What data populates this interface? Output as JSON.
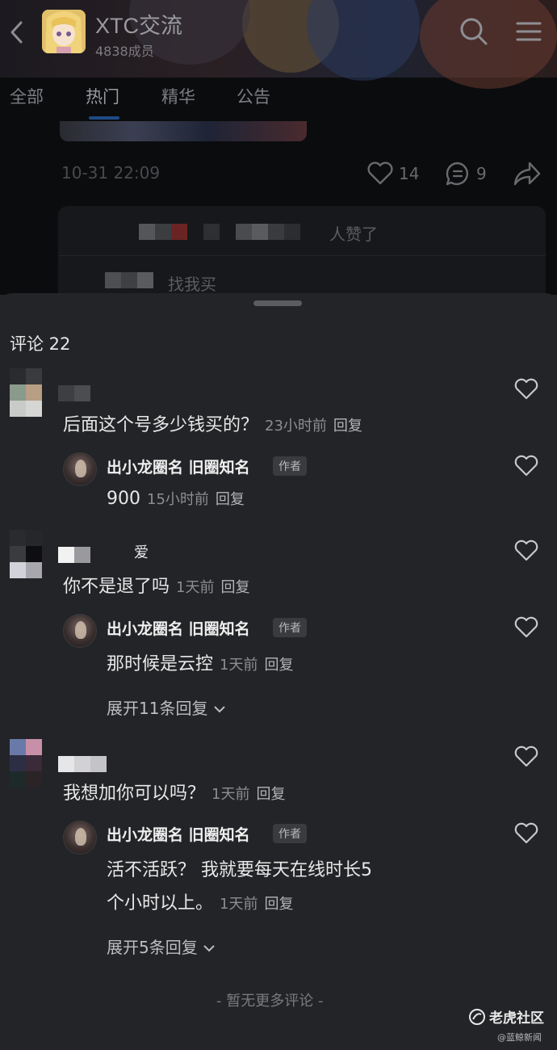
{
  "header": {
    "title": "XTC交流",
    "members": "4838成员"
  },
  "tabs": [
    "全部",
    "热门",
    "精华",
    "公告"
  ],
  "post": {
    "time": "10-31 22:09",
    "likes": "14",
    "comments": "9",
    "liked_suffix": "人赞了",
    "reply_preview": "找我买"
  },
  "comments": {
    "title": "评论 22",
    "items": [
      {
        "text": "后面这个号多少钱买的？",
        "time": "23小时前",
        "reply_label": "回复",
        "author_reply": {
          "name": "出小龙圈名 旧圈知名",
          "badge": "作者",
          "text": "900",
          "time": "15小时前",
          "reply_label": "回复"
        }
      },
      {
        "name_suffix": "爱",
        "text": "你不是退了吗",
        "time": "1天前",
        "reply_label": "回复",
        "author_reply": {
          "name": "出小龙圈名 旧圈知名",
          "badge": "作者",
          "text": "那时候是云控",
          "time": "1天前",
          "reply_label": "回复"
        },
        "expand": "展开11条回复"
      },
      {
        "text": "我想加你可以吗？",
        "time": "1天前",
        "reply_label": "回复",
        "author_reply": {
          "name": "出小龙圈名 旧圈知名",
          "badge": "作者",
          "text_line1": "活不活跃？ 我就要每天在线时长5",
          "text_line2": "个小时以上。",
          "time": "1天前",
          "reply_label": "回复"
        },
        "expand": "展开5条回复"
      }
    ],
    "no_more": "- 暂无更多评论 -"
  },
  "watermark": {
    "main": "老虎社区",
    "sub": "@蓝鲸新闻"
  }
}
